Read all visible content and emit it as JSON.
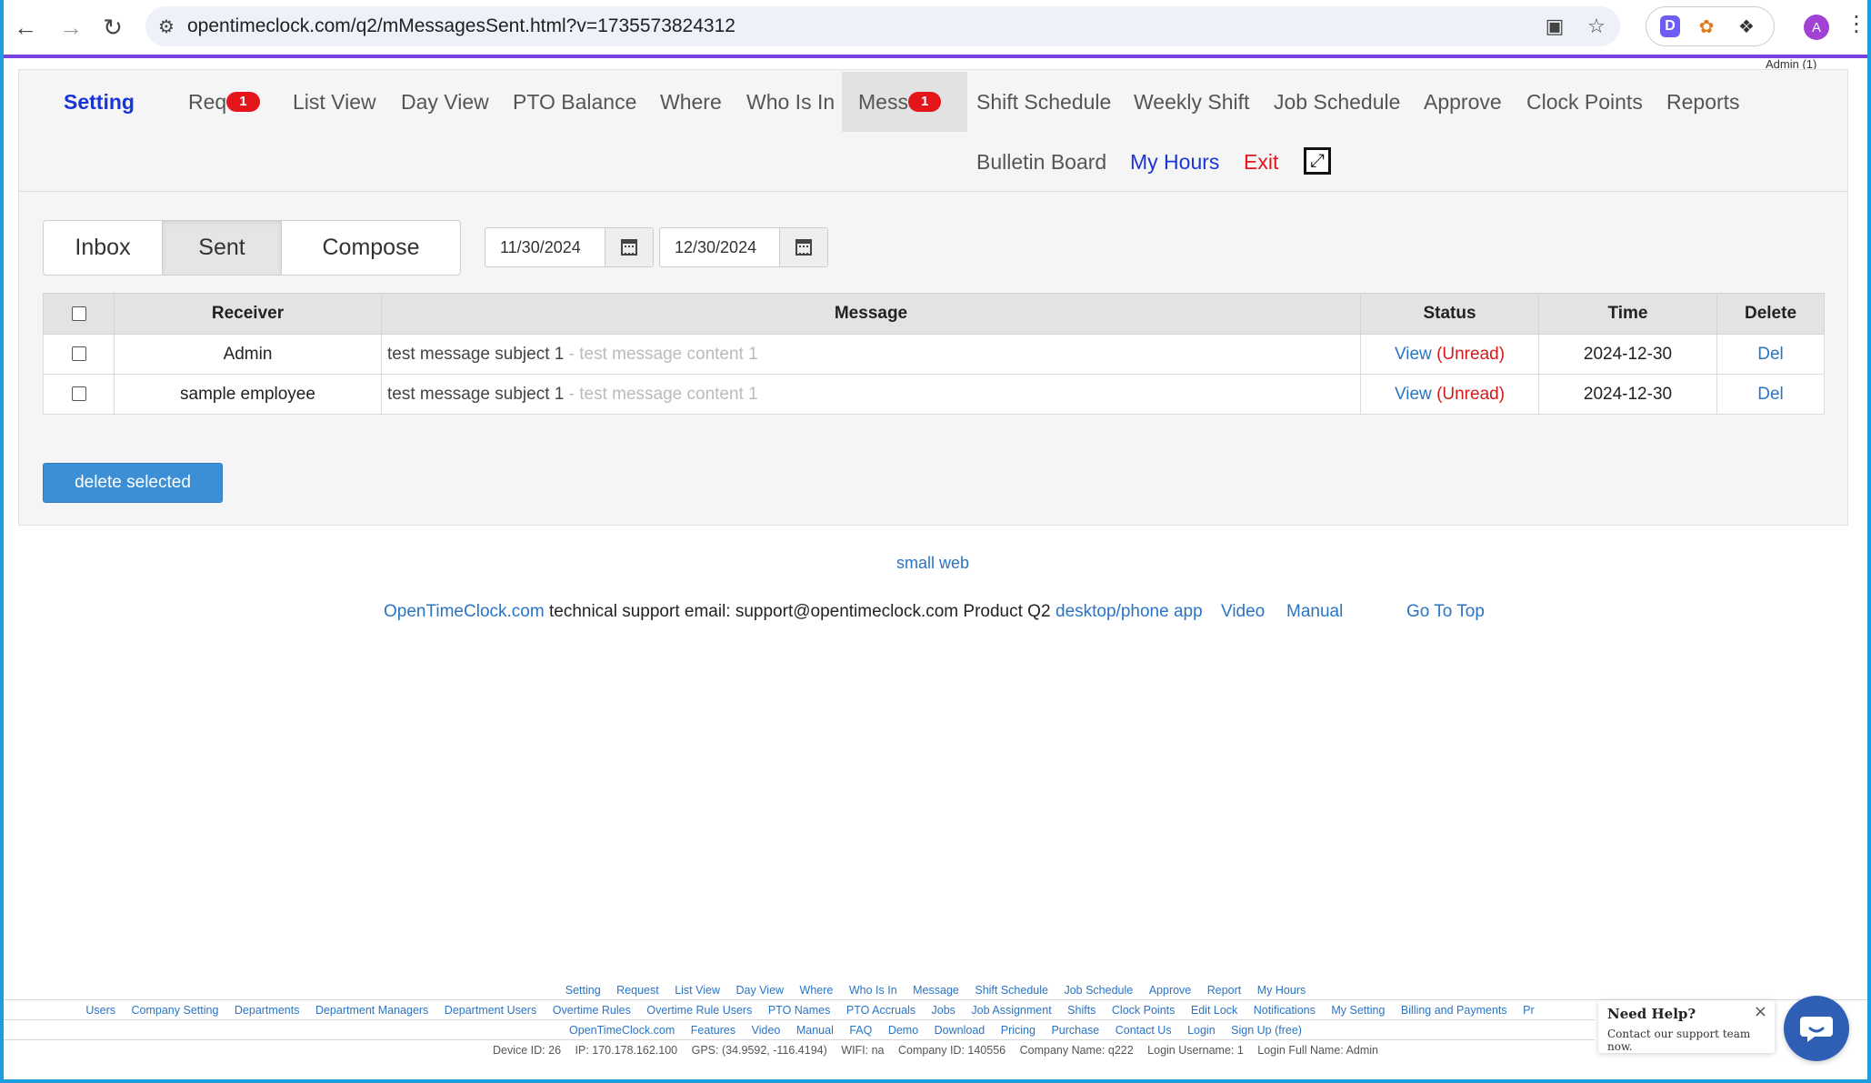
{
  "browser": {
    "url": "opentimeclock.com/q2/mMessagesSent.html?v=1735573824312",
    "avatar_letter": "A",
    "admin_label": "Admin (1)"
  },
  "nav": {
    "brand": "Setting",
    "request": "Req",
    "request_badge": "1",
    "list_view": "List View",
    "day_view": "Day View",
    "pto_balance": "PTO Balance",
    "where": "Where",
    "who_is_in": "Who Is In",
    "messages": "Mess",
    "messages_badge": "1",
    "shift_schedule": "Shift Schedule",
    "weekly_shift": "Weekly Shift",
    "job_schedule": "Job Schedule",
    "approve": "Approve",
    "clock_points": "Clock Points",
    "reports": "Reports",
    "bulletin_board": "Bulletin Board",
    "my_hours": "My Hours",
    "exit": "Exit"
  },
  "tabs": {
    "inbox": "Inbox",
    "sent": "Sent",
    "compose": "Compose"
  },
  "filters": {
    "start_date": "11/30/2024",
    "end_date": "12/30/2024"
  },
  "table": {
    "headers": {
      "receiver": "Receiver",
      "message": "Message",
      "status": "Status",
      "time": "Time",
      "delete": "Delete"
    },
    "rows": [
      {
        "receiver": "Admin",
        "subject": "test message subject 1",
        "dash": " - ",
        "content": "test message content 1",
        "view": "View",
        "status": "Unread",
        "time": "2024-12-30",
        "delete": "Del"
      },
      {
        "receiver": "sample employee",
        "subject": "test message subject 1",
        "dash": " - ",
        "content": "test message content 1",
        "view": "View",
        "status": "Unread",
        "time": "2024-12-30",
        "delete": "Del"
      }
    ]
  },
  "actions": {
    "delete_selected": "delete selected"
  },
  "links": {
    "small_web": "small web",
    "opentimeclock": "OpenTimeClock.com",
    "support_text": "technical support email: support@opentimeclock.com Product Q2",
    "desktop_app": "desktop/phone app",
    "video": "Video",
    "manual": "Manual",
    "go_to_top": "Go To Top"
  },
  "footer": {
    "row1": [
      "Setting",
      "Request",
      "List View",
      "Day View",
      "Where",
      "Who Is In",
      "Message",
      "Shift Schedule",
      "Job Schedule",
      "Approve",
      "Report",
      "My Hours"
    ],
    "row2": [
      "Users",
      "Company Setting",
      "Departments",
      "Department Managers",
      "Department Users",
      "Overtime Rules",
      "Overtime Rule Users",
      "PTO Names",
      "PTO Accruals",
      "Jobs",
      "Job Assignment",
      "Shifts",
      "Clock Points",
      "Edit Lock",
      "Notifications",
      "My Setting",
      "Billing and Payments",
      "Pr"
    ],
    "row3": [
      "OpenTimeClock.com",
      "Features",
      "Video",
      "Manual",
      "FAQ",
      "Demo",
      "Download",
      "Pricing",
      "Purchase",
      "Contact Us",
      "Login",
      "Sign Up (free)"
    ],
    "info": {
      "device_id": "Device ID: 26",
      "ip": "IP: 170.178.162.100",
      "gps": "GPS: (34.9592, -116.4194)",
      "wifi": "WIFI: na",
      "company_id": "Company ID: 140556",
      "company_name": "Company Name: q222",
      "login_username": "Login Username: 1",
      "login_full_name": "Login Full Name: Admin"
    }
  },
  "help": {
    "title": "Need Help?",
    "subtitle": "Contact our support team now.",
    "close": "×"
  },
  "colors": {
    "brand_blue": "#1a35d6",
    "badge_red": "#e4161c",
    "link_blue": "#2a74c5",
    "button_blue": "#3c8fd5",
    "accent_purple": "#7a3fe0"
  }
}
